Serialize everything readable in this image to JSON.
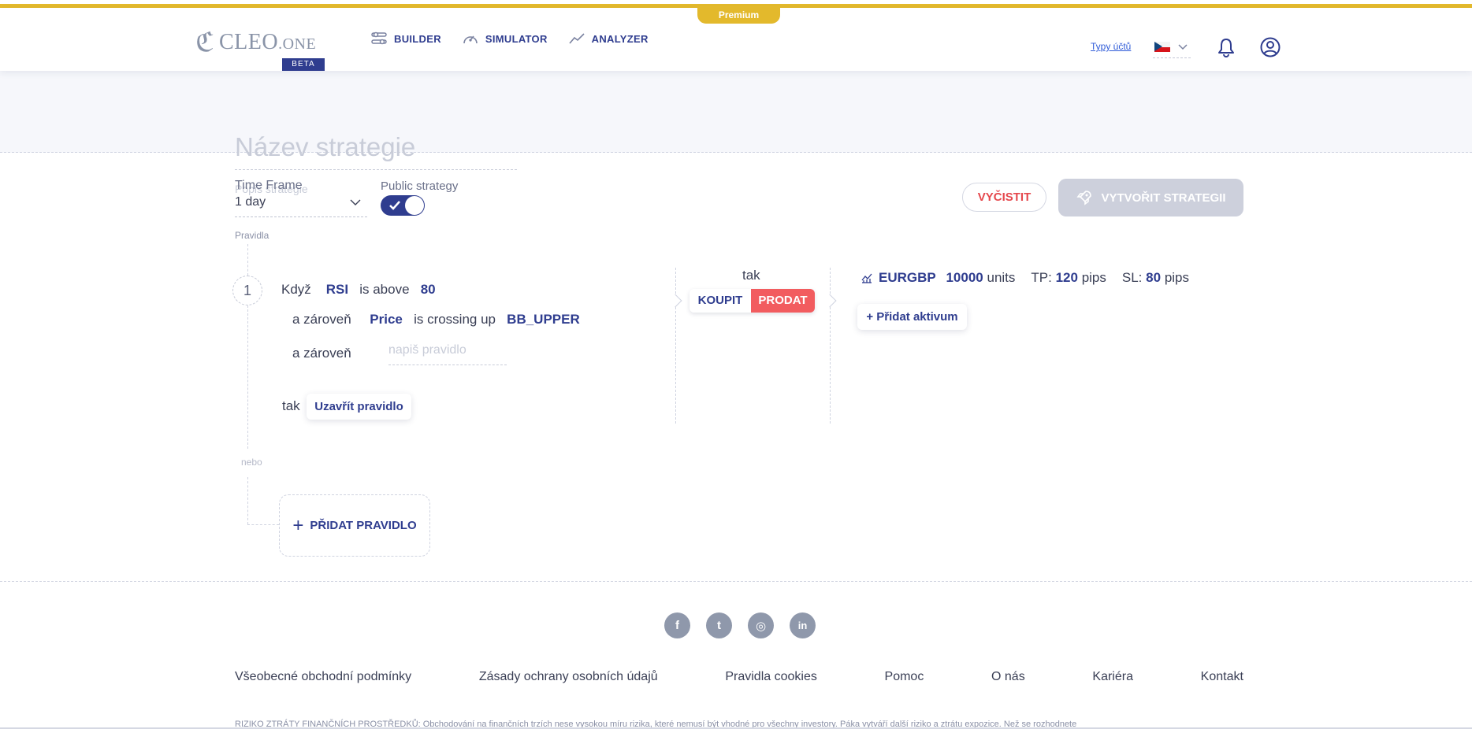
{
  "header": {
    "premium_label": "Premium",
    "logo_text": "CLEO",
    "logo_suffix": ".ONE",
    "logo_badge": "BETA",
    "nav": [
      {
        "label": "BUILDER",
        "icon": "sliders-icon"
      },
      {
        "label": "SIMULATOR",
        "icon": "speedometer-icon"
      },
      {
        "label": "ANALYZER",
        "icon": "trend-line-icon"
      }
    ],
    "account_types_link": "Typy účtů",
    "language_flag": "czech-flag-icon"
  },
  "strategy": {
    "name_placeholder": "Název strategie",
    "description_placeholder": "Popis strategie"
  },
  "controls": {
    "timeframe_label": "Time Frame",
    "timeframe_value": "1 day",
    "public_label": "Public strategy",
    "public_enabled": true,
    "clear_button": "VYČISTIT",
    "create_button": "VYTVOŘIT STRATEGII"
  },
  "rules": {
    "section_label": "Pravidla",
    "rule": {
      "number": "1",
      "when": "Když",
      "c1_indicator": "RSI",
      "c1_operator": "is above",
      "c1_value": "80",
      "and": "a zároveň",
      "c2_indicator": "Price",
      "c2_operator": "is crossing up",
      "c2_value": "BB_UPPER",
      "and2": "a zároveň",
      "new_condition_placeholder": "napiš pravidlo",
      "then": "tak",
      "close_rule_button": "Uzavřít pravidlo"
    },
    "action": {
      "then": "tak",
      "buy": "KOUPIT",
      "sell": "PRODAT",
      "selected": "PRODAT"
    },
    "asset": {
      "symbol": "EURGBP",
      "units_value": "10000",
      "units_label": "units",
      "tp_label": "TP:",
      "tp_value": "120",
      "sl_label": "SL:",
      "sl_value": "80",
      "pips_label": "pips",
      "add_asset_button": "+ Přidat aktivum"
    },
    "or_label": "nebo",
    "add_rule_button": "PŘIDAT PRAVIDLO"
  },
  "footer": {
    "socials": [
      "facebook-icon",
      "twitter-icon",
      "instagram-icon",
      "linkedin-icon"
    ],
    "social_glyphs": [
      "f",
      "t",
      "◎",
      "in"
    ],
    "links": [
      "Všeobecné obchodní podmínky",
      "Zásady ochrany osobních údajů",
      "Pravidla cookies",
      "Pomoc",
      "O nás",
      "Kariéra",
      "Kontakt"
    ],
    "risk_text": "RIZIKO ZTRÁTY FINANČNÍCH PROSTŘEDKŮ: Obchodování na finančních trzích nese vysokou míru rizika, které nemusí být vhodné pro všechny investory. Páka vytváří další riziko a ztrátu expozice. Než se rozhodnete"
  },
  "colors": {
    "brand": "#2f3d8f",
    "accent_gold": "#e3b92c",
    "sell_red": "#f25c5f",
    "clear_red": "#e5484d"
  }
}
